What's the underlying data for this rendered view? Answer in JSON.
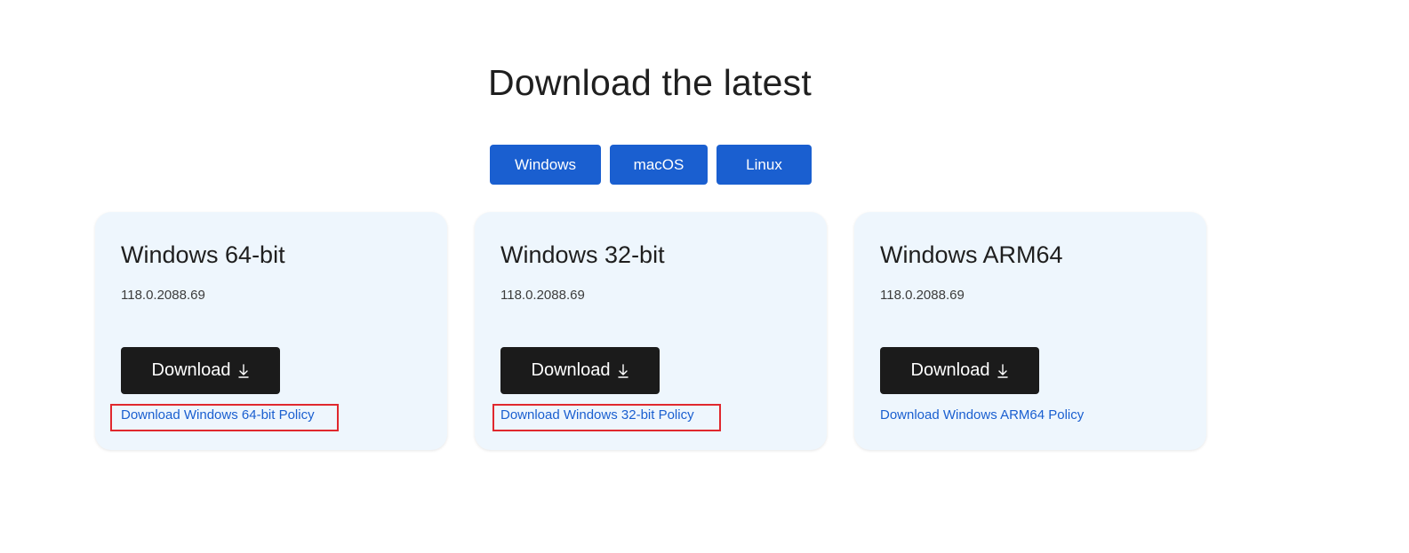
{
  "heading": "Download the latest",
  "platform_tabs": [
    {
      "label": "Windows"
    },
    {
      "label": "macOS"
    },
    {
      "label": "Linux"
    }
  ],
  "cards": [
    {
      "title": "Windows 64-bit",
      "version": "118.0.2088.69",
      "download_label": "Download",
      "policy_link": "Download Windows 64-bit Policy"
    },
    {
      "title": "Windows 32-bit",
      "version": "118.0.2088.69",
      "download_label": "Download",
      "policy_link": "Download Windows 32-bit Policy"
    },
    {
      "title": "Windows ARM64",
      "version": "118.0.2088.69",
      "download_label": "Download",
      "policy_link": "Download Windows ARM64 Policy"
    }
  ],
  "icons": {
    "download": "download-arrow-icon"
  },
  "colors": {
    "tab_background": "#1a5fd0",
    "card_background": "#eef6fd",
    "download_button": "#1b1b1b",
    "link": "#1a5fd0",
    "highlight": "#e0282e"
  },
  "highlighted_links": [
    0,
    1
  ]
}
